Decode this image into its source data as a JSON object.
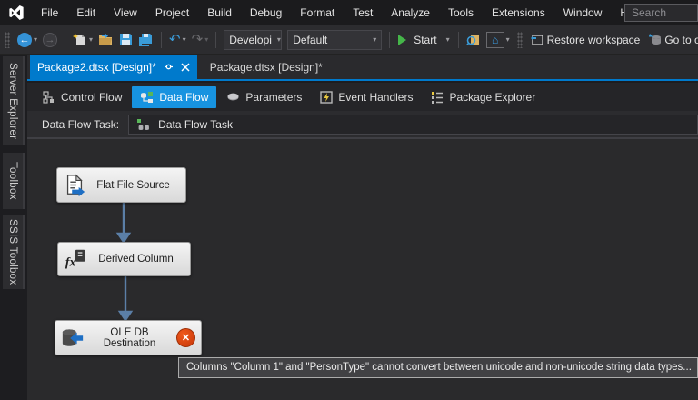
{
  "colors": {
    "accent": "#007acc",
    "dataflow_active": "#1793e0",
    "error": "#d2400e",
    "arrow": "#5b7fa7"
  },
  "menu": {
    "items": [
      "File",
      "Edit",
      "View",
      "Project",
      "Build",
      "Debug",
      "Format",
      "Test",
      "Analyze",
      "Tools",
      "Extensions",
      "Window",
      "Help"
    ],
    "search_placeholder": "Search"
  },
  "toolbar": {
    "config_dropdown": "Developi",
    "platform_dropdown": "Default",
    "start_label": "Start",
    "restore_workspace_label": "Restore workspace",
    "goto_object_label": "Go to ob"
  },
  "doc_tabs": [
    {
      "label": "Package2.dtsx [Design]*",
      "active": true
    },
    {
      "label": "Package.dtsx [Design]*",
      "active": false
    }
  ],
  "designer_tabs": [
    {
      "label": "Control Flow"
    },
    {
      "label": "Data Flow",
      "active": true
    },
    {
      "label": "Parameters"
    },
    {
      "label": "Event Handlers"
    },
    {
      "label": "Package Explorer"
    }
  ],
  "side_tabs": [
    {
      "label": "Server Explorer"
    },
    {
      "label": "Toolbox"
    },
    {
      "label": "SSIS Toolbox"
    }
  ],
  "task_selector": {
    "label": "Data Flow Task:",
    "value": "Data Flow Task"
  },
  "canvas": {
    "nodes": [
      {
        "label": "Flat File Source"
      },
      {
        "label": "Derived Column"
      },
      {
        "label": "OLE DB Destination",
        "error": true
      }
    ],
    "error_tooltip": "Columns \"Column 1\" and \"PersonType\" cannot convert between unicode and non-unicode string data types..."
  }
}
